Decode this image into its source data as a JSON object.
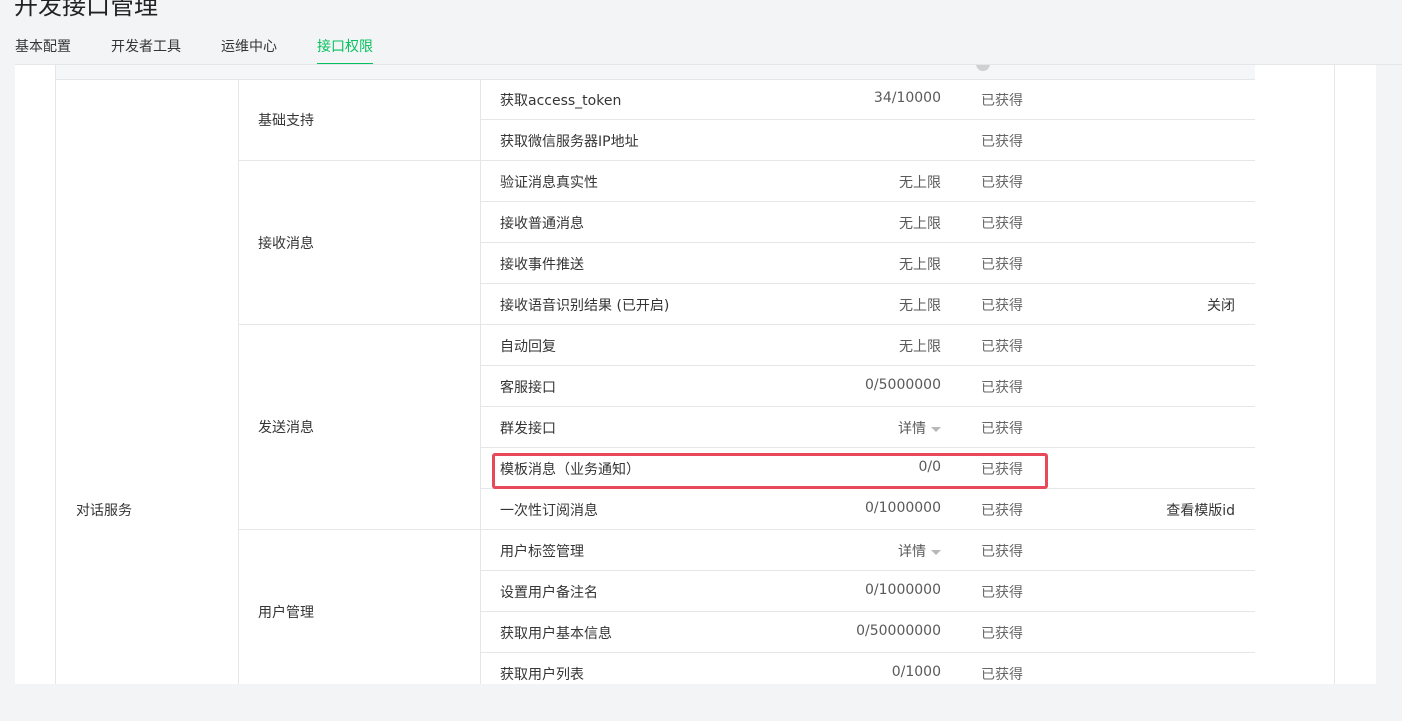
{
  "page": {
    "title": "开发接口管理"
  },
  "tabs": [
    {
      "label": "基本配置",
      "active": false
    },
    {
      "label": "开发者工具",
      "active": false
    },
    {
      "label": "运维中心",
      "active": false
    },
    {
      "label": "接口权限",
      "active": true
    }
  ],
  "colors": {
    "accent": "#07c160",
    "highlight": "#e8495a"
  },
  "service": {
    "label": "对话服务"
  },
  "groups": [
    {
      "label": "基础支持",
      "rows": [
        {
          "name": "获取access_token",
          "quota": "34/10000",
          "status": "已获得",
          "action": ""
        },
        {
          "name": "获取微信服务器IP地址",
          "quota": "",
          "status": "已获得",
          "action": ""
        }
      ]
    },
    {
      "label": "接收消息",
      "rows": [
        {
          "name": "验证消息真实性",
          "quota": "无上限",
          "status": "已获得",
          "action": ""
        },
        {
          "name": "接收普通消息",
          "quota": "无上限",
          "status": "已获得",
          "action": ""
        },
        {
          "name": "接收事件推送",
          "quota": "无上限",
          "status": "已获得",
          "action": ""
        },
        {
          "name": "接收语音识别结果 (已开启)",
          "quota": "无上限",
          "status": "已获得",
          "action": "关闭"
        }
      ]
    },
    {
      "label": "发送消息",
      "rows": [
        {
          "name": "自动回复",
          "quota": "无上限",
          "status": "已获得",
          "action": ""
        },
        {
          "name": "客服接口",
          "quota": "0/5000000",
          "status": "已获得",
          "action": ""
        },
        {
          "name": "群发接口",
          "quota": "详情",
          "quota_dropdown": true,
          "status": "已获得",
          "action": ""
        },
        {
          "name": "模板消息（业务通知）",
          "quota": "0/0",
          "status": "已获得",
          "action": "",
          "highlighted": true
        },
        {
          "name": "一次性订阅消息",
          "quota": "0/1000000",
          "status": "已获得",
          "action": "查看模版id"
        }
      ]
    },
    {
      "label": "用户管理",
      "rows": [
        {
          "name": "用户标签管理",
          "quota": "详情",
          "quota_dropdown": true,
          "status": "已获得",
          "action": ""
        },
        {
          "name": "设置用户备注名",
          "quota": "0/1000000",
          "status": "已获得",
          "action": ""
        },
        {
          "name": "获取用户基本信息",
          "quota": "0/50000000",
          "status": "已获得",
          "action": ""
        },
        {
          "name": "获取用户列表",
          "quota": "0/1000",
          "status": "已获得",
          "action": ""
        }
      ]
    }
  ]
}
